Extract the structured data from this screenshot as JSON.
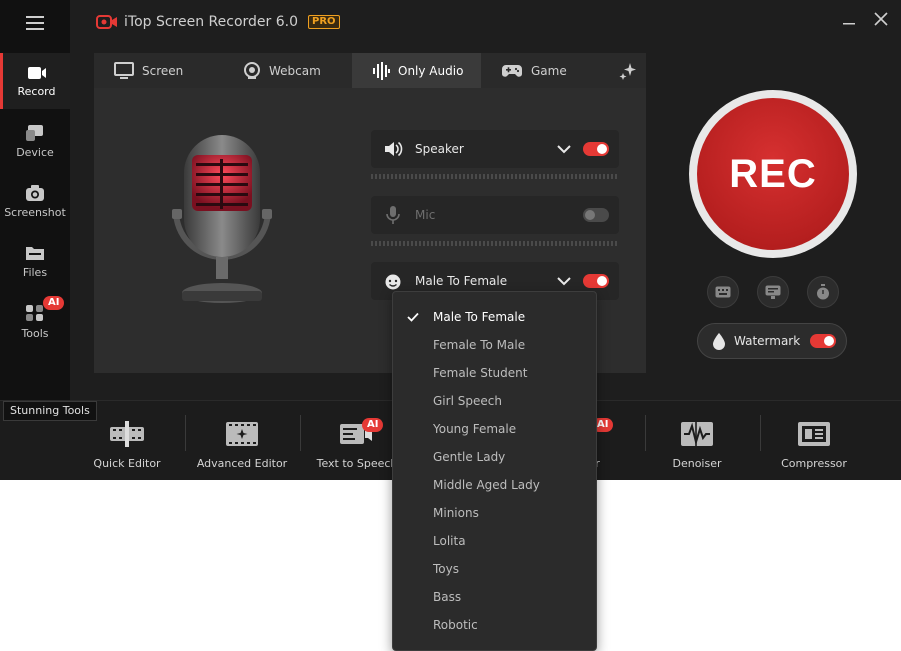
{
  "app": {
    "title": "iTop Screen Recorder 6.0",
    "pro_badge": "PRO",
    "accent_color": "#e53935"
  },
  "sidebar": {
    "items": [
      {
        "label": "Record",
        "icon": "record-icon",
        "active": true
      },
      {
        "label": "Device",
        "icon": "device-icon"
      },
      {
        "label": "Screenshot",
        "icon": "camera-icon"
      },
      {
        "label": "Files",
        "icon": "folder-icon"
      },
      {
        "label": "Tools",
        "icon": "tools-icon",
        "badge": "AI"
      }
    ]
  },
  "tabs": [
    {
      "label": "Screen",
      "icon": "monitor-icon"
    },
    {
      "label": "Webcam",
      "icon": "webcam-icon"
    },
    {
      "label": "Only Audio",
      "icon": "audio-wave-icon",
      "active": true
    },
    {
      "label": "Game",
      "icon": "gamepad-icon"
    }
  ],
  "audio": {
    "speaker": {
      "label": "Speaker",
      "enabled": true
    },
    "mic": {
      "label": "Mic",
      "enabled": false
    },
    "voice_changer": {
      "label": "Male To Female",
      "enabled": true
    }
  },
  "rec": {
    "label": "REC"
  },
  "watermark": {
    "label": "Watermark",
    "enabled": true
  },
  "tools": {
    "section_label": "Stunning Tools",
    "items": [
      {
        "label": "Quick Editor",
        "icon": "film-edit-icon"
      },
      {
        "label": "Advanced Editor",
        "icon": "film-sparkle-icon"
      },
      {
        "label": "Text to Speech",
        "icon": "text-speech-icon",
        "badge": "AI"
      },
      {
        "label": "ur",
        "icon": "",
        "badge": "AI"
      },
      {
        "label": "Denoiser",
        "icon": "denoiser-icon"
      },
      {
        "label": "Compressor",
        "icon": "compressor-icon"
      }
    ]
  },
  "voice_dropdown": {
    "selected": "Male To Female",
    "options": [
      "Male To Female",
      "Female To Male",
      "Female Student",
      "Girl Speech",
      "Young Female",
      "Gentle Lady",
      "Middle Aged Lady",
      "Minions",
      "Lolita",
      "Toys",
      "Bass",
      "Robotic"
    ]
  }
}
